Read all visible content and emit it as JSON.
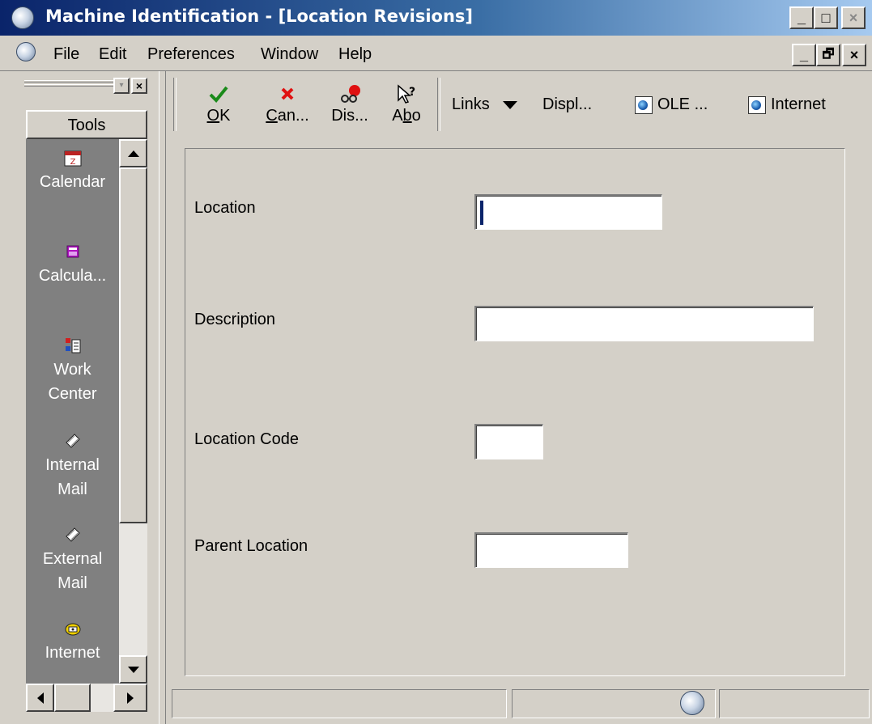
{
  "window": {
    "title": "Machine Identification - [Location Revisions]",
    "minimize_glyph": "_",
    "maximize_glyph": "□",
    "close_glyph": "×",
    "restore_glyph": "🗗"
  },
  "menu": {
    "items": [
      "File",
      "Edit",
      "Preferences",
      "Window",
      "Help"
    ]
  },
  "tools": {
    "header": "Tools",
    "items": [
      {
        "label": "Calendar",
        "icon": "calendar-icon"
      },
      {
        "label": "Calcula...",
        "icon": "calculator-icon"
      },
      {
        "label": "Work Center",
        "icon": "work-center-icon"
      },
      {
        "label": "Internal Mail",
        "icon": "internal-mail-icon"
      },
      {
        "label": "External Mail",
        "icon": "external-mail-icon"
      },
      {
        "label": "Internet",
        "icon": "phone-icon"
      }
    ]
  },
  "toolbar": {
    "ok": {
      "mnemonic": "O",
      "rest": "K",
      "icon": "checkmark-icon",
      "color": "#1a8a1a"
    },
    "cancel": {
      "mnemonic": "C",
      "rest": "an...",
      "icon": "x-icon",
      "color": "#e01010"
    },
    "display": {
      "label": "Dis...",
      "icon": "glasses-icon"
    },
    "about": {
      "pre": "A",
      "mnemonic": "b",
      "rest": "o",
      "icon": "help-pointer-icon"
    },
    "links": "Links",
    "display_menu": "Displ...",
    "ole": "OLE ...",
    "internet": "Internet"
  },
  "form": {
    "location": {
      "label": "Location",
      "value": ""
    },
    "description": {
      "label": "Description",
      "value": ""
    },
    "location_code": {
      "label": "Location Code",
      "value": ""
    },
    "parent_location": {
      "label": "Parent Location",
      "value": ""
    }
  }
}
